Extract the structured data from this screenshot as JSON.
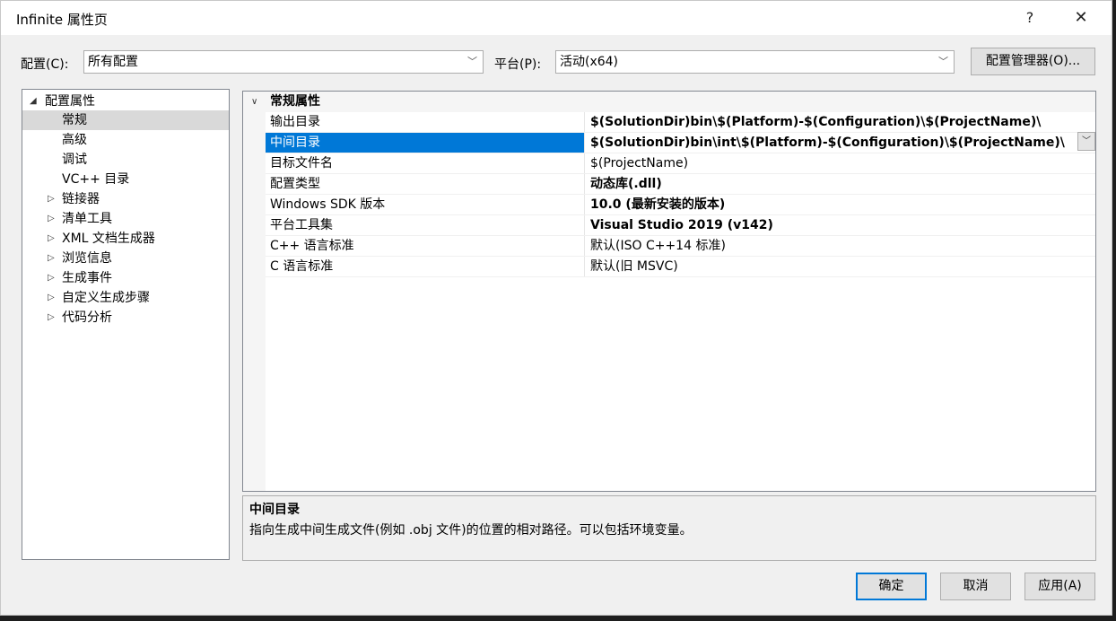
{
  "window": {
    "title": "Infinite 属性页",
    "help_glyph": "?",
    "close_glyph": "✕"
  },
  "config": {
    "label": "配置(C):",
    "value": "所有配置"
  },
  "platform": {
    "label": "平台(P):",
    "value": "活动(x64)"
  },
  "config_manager_label": "配置管理器(O)...",
  "tree": {
    "root": {
      "label": "配置属性",
      "expanded": true
    },
    "items": [
      {
        "label": "常规",
        "selected": true
      },
      {
        "label": "高级"
      },
      {
        "label": "调试"
      },
      {
        "label": "VC++ 目录"
      },
      {
        "label": "链接器",
        "collapsed": true
      },
      {
        "label": "清单工具",
        "collapsed": true
      },
      {
        "label": "XML 文档生成器",
        "collapsed": true
      },
      {
        "label": "浏览信息",
        "collapsed": true
      },
      {
        "label": "生成事件",
        "collapsed": true
      },
      {
        "label": "自定义生成步骤",
        "collapsed": true
      },
      {
        "label": "代码分析",
        "collapsed": true
      }
    ]
  },
  "grid": {
    "category": "常规属性",
    "rows": [
      {
        "name": "输出目录",
        "value": "$(SolutionDir)bin\\$(Platform)-$(Configuration)\\$(ProjectName)\\",
        "bold": true
      },
      {
        "name": "中间目录",
        "value": "$(SolutionDir)bin\\int\\$(Platform)-$(Configuration)\\$(ProjectName)\\",
        "bold": true,
        "selected": true
      },
      {
        "name": "目标文件名",
        "value": "$(ProjectName)"
      },
      {
        "name": "配置类型",
        "value": "动态库(.dll)",
        "bold": true
      },
      {
        "name": "Windows SDK 版本",
        "value": "10.0 (最新安装的版本)",
        "bold": true
      },
      {
        "name": "平台工具集",
        "value": "Visual Studio 2019 (v142)",
        "bold": true
      },
      {
        "name": "C++ 语言标准",
        "value": "默认(ISO C++14 标准)"
      },
      {
        "name": "C 语言标准",
        "value": "默认(旧 MSVC)"
      }
    ]
  },
  "description": {
    "title": "中间目录",
    "text": "指向生成中间生成文件(例如 .obj 文件)的位置的相对路径。可以包括环境变量。"
  },
  "buttons": {
    "ok": "确定",
    "cancel": "取消",
    "apply": "应用(A)"
  },
  "icons": {
    "expanded": "triangle-down-icon",
    "collapsed": "triangle-right-icon",
    "dropdown": "chevron-down-icon"
  }
}
